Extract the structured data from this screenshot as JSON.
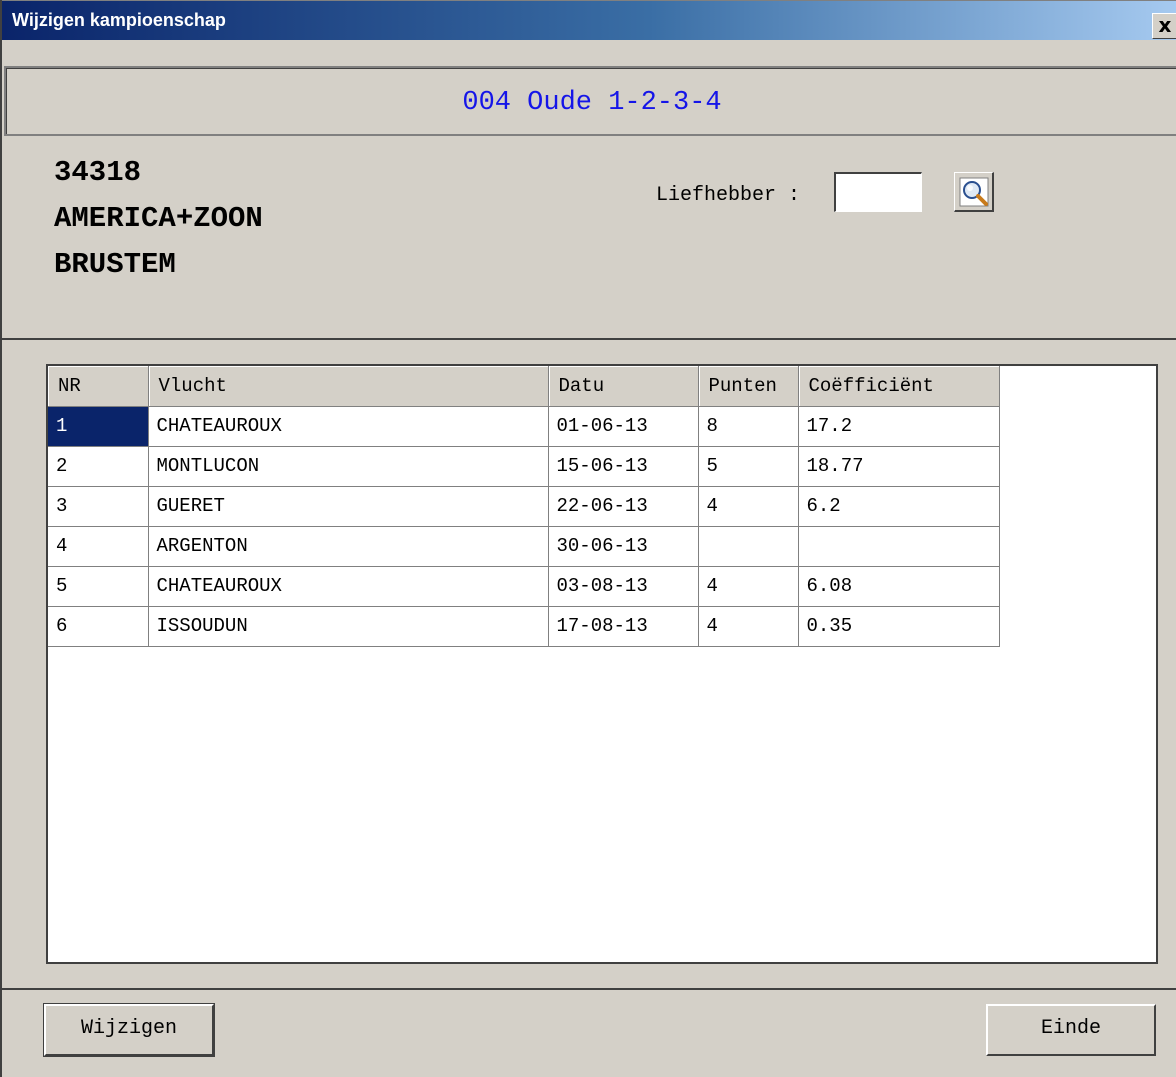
{
  "window": {
    "title": "Wijzigen kampioenschap",
    "close_label": "x"
  },
  "header": {
    "competition": "004 Oude 1-2-3-4"
  },
  "member": {
    "number": "34318",
    "name": "AMERICA+ZOON",
    "city": "BRUSTEM"
  },
  "liefhebber": {
    "label": "Liefhebber :",
    "value": ""
  },
  "table": {
    "columns": [
      "NR",
      "Vlucht",
      "Datu",
      "Punten",
      "Coëfficiënt"
    ],
    "rows": [
      [
        "1",
        "CHATEAUROUX",
        "01-06-13",
        "8",
        "17.2"
      ],
      [
        "2",
        "MONTLUCON",
        "15-06-13",
        "5",
        "18.77"
      ],
      [
        "3",
        "GUERET",
        "22-06-13",
        "4",
        "6.2"
      ],
      [
        "4",
        "ARGENTON",
        "30-06-13",
        "",
        ""
      ],
      [
        "5",
        "CHATEAUROUX",
        "03-08-13",
        "4",
        "6.08"
      ],
      [
        "6",
        "ISSOUDUN",
        "17-08-13",
        "4",
        "0.35"
      ]
    ]
  },
  "buttons": {
    "wijzigen": "Wijzigen",
    "einde": "Einde"
  },
  "icons": {
    "search": "magnifier-icon",
    "close": "close-icon"
  },
  "colors": {
    "title_gradient_start": "#0a246a",
    "competition_text": "#1515e8",
    "selection": "#0a246a"
  }
}
